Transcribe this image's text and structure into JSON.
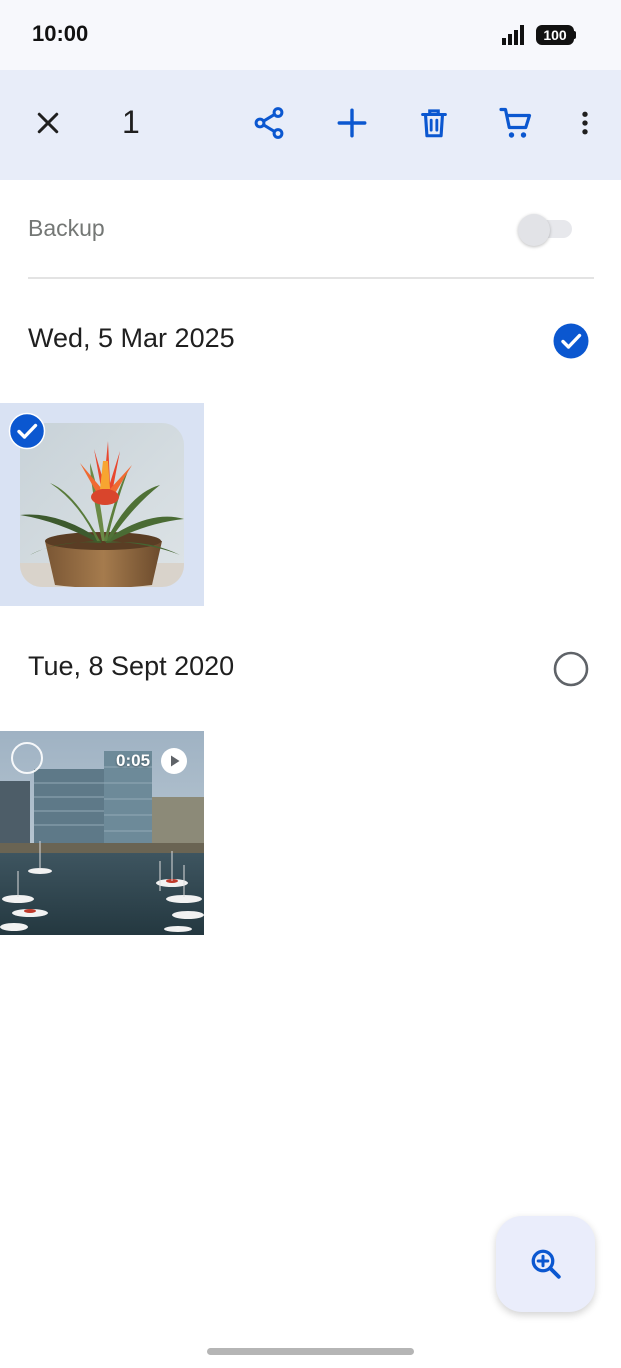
{
  "status_bar": {
    "time": "10:00",
    "battery": "100",
    "signal_icon": "signal-icon"
  },
  "action_bar": {
    "selected_count": "1",
    "close_icon": "close-icon",
    "share_icon": "share-icon",
    "add_icon": "add-icon",
    "delete_icon": "delete-icon",
    "order_prints_icon": "shopping-cart-icon",
    "more_icon": "more-vert-icon",
    "accent_color": "#0b57d0"
  },
  "backup": {
    "label": "Backup",
    "enabled": false
  },
  "groups": [
    {
      "date": "Wed, 5 Mar 2025",
      "all_selected": true,
      "items": [
        {
          "type": "photo",
          "selected": true,
          "subject": "plant"
        }
      ]
    },
    {
      "date": "Tue, 8 Sept 2020",
      "all_selected": false,
      "items": [
        {
          "type": "video",
          "selected": false,
          "duration": "0:05"
        }
      ]
    }
  ],
  "fab": {
    "icon": "zoom-in-icon"
  }
}
